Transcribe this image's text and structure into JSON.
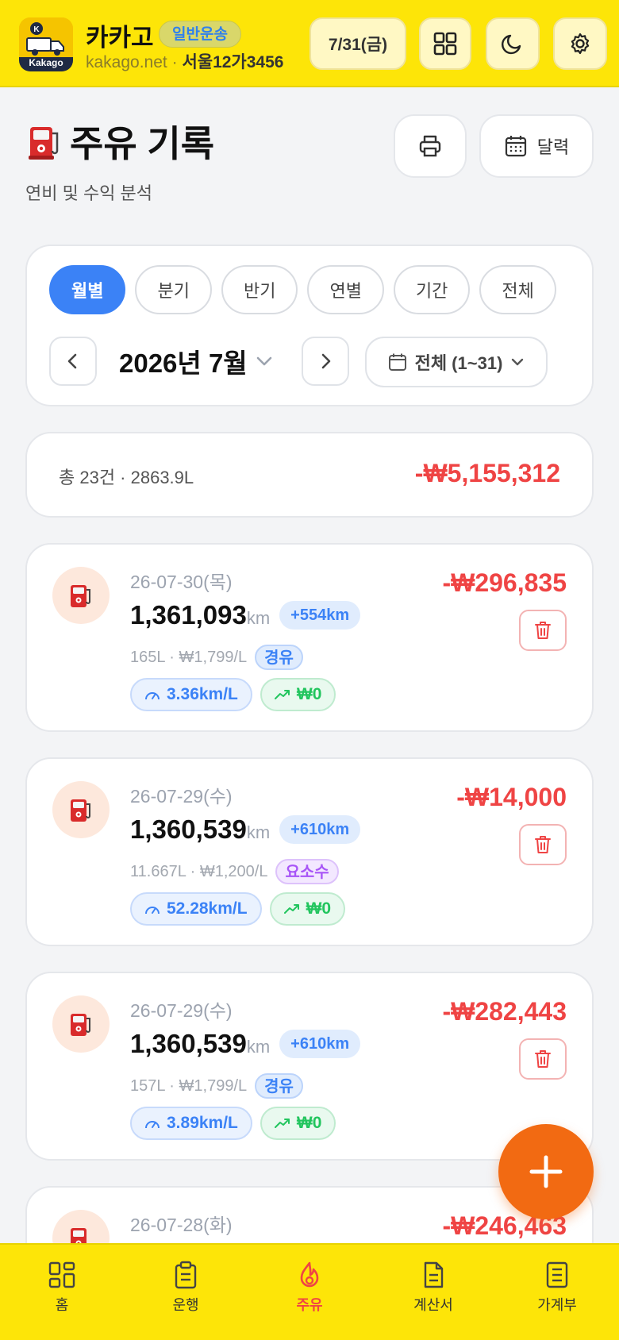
{
  "header": {
    "logo_text": "Kakago",
    "brand": "카카고",
    "badge": "일반운송",
    "domain": "kakago.net",
    "separator": "·",
    "plate": "서울12가3456",
    "date": "7/31(금)"
  },
  "page": {
    "title": "주유 기록",
    "subtitle": "연비 및 수익 분석",
    "calendar_label": "달력"
  },
  "filter": {
    "tabs": [
      {
        "label": "월별",
        "active": true
      },
      {
        "label": "분기",
        "active": false
      },
      {
        "label": "반기",
        "active": false
      },
      {
        "label": "연별",
        "active": false
      },
      {
        "label": "기간",
        "active": false
      },
      {
        "label": "전체",
        "active": false
      }
    ],
    "month": "2026년 7월",
    "range": "전체 (1~31)"
  },
  "summary": {
    "count_text": "총 23건 · 2863.9L",
    "total": "-₩5,155,312"
  },
  "records": [
    {
      "date": "26-07-30(목)",
      "odometer": "1,361,093",
      "unit": "km",
      "distance": "+554km",
      "meta": "165L · ₩1,799/L",
      "fuel": "경유",
      "fuel_type": "diesel",
      "efficiency": "3.36km/L",
      "profit": "₩0",
      "amount": "-₩296,835"
    },
    {
      "date": "26-07-29(수)",
      "odometer": "1,360,539",
      "unit": "km",
      "distance": "+610km",
      "meta": "11.667L · ₩1,200/L",
      "fuel": "요소수",
      "fuel_type": "urea",
      "efficiency": "52.28km/L",
      "profit": "₩0",
      "amount": "-₩14,000"
    },
    {
      "date": "26-07-29(수)",
      "odometer": "1,360,539",
      "unit": "km",
      "distance": "+610km",
      "meta": "157L · ₩1,799/L",
      "fuel": "경유",
      "fuel_type": "diesel",
      "efficiency": "3.89km/L",
      "profit": "₩0",
      "amount": "-₩282,443"
    },
    {
      "date": "26-07-28(화)",
      "amount": "-₩246,463"
    }
  ],
  "bottom_nav": [
    {
      "label": "홈",
      "icon": "home-grid-icon",
      "active": false
    },
    {
      "label": "운행",
      "icon": "clipboard-icon",
      "active": false
    },
    {
      "label": "주유",
      "icon": "flame-icon",
      "active": true
    },
    {
      "label": "계산서",
      "icon": "document-icon",
      "active": false
    },
    {
      "label": "가계부",
      "icon": "ledger-icon",
      "active": false
    }
  ],
  "colors": {
    "header_bg": "#fde508",
    "accent_blue": "#3b82f6",
    "expense_red": "#ef4444",
    "fab_orange": "#f26a12",
    "profit_green": "#22c55e"
  }
}
